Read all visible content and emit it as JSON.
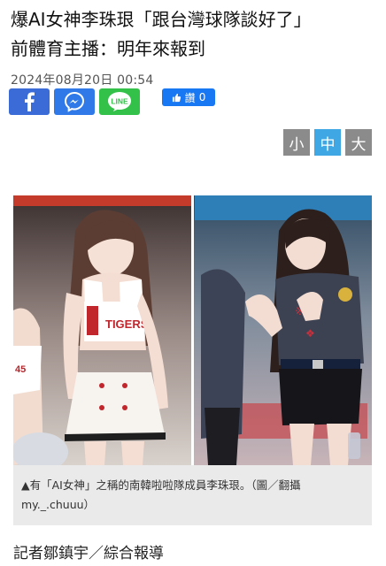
{
  "article": {
    "headline_line1": "爆AI女神李珠珢「跟台灣球隊談好了」",
    "headline_line2": "前體育主播：明年來報到",
    "date": "2024年08月20日  00:54"
  },
  "share": {
    "facebook_icon": "facebook-icon",
    "messenger_icon": "messenger-icon",
    "line_icon": "line-icon",
    "line_label": "LINE",
    "like_label": "讚",
    "like_count": "0",
    "brand_colors": {
      "facebook": "#3b6bd6",
      "messenger": "#2f7ae8",
      "line": "#33c14a",
      "like": "#1877f2"
    }
  },
  "font_size": {
    "small": "小",
    "medium": "中",
    "large": "大",
    "active": "medium",
    "active_color": "#3fa7e4",
    "inactive_color": "#8b8b8b"
  },
  "photo": {
    "jersey_left": "TIGERS",
    "jersey_left_side": "45"
  },
  "caption": {
    "text": "▲有「AI女神」之稱的南韓啦啦隊成員李珠珢。（圖／翻攝my._.chuuu）"
  },
  "byline": {
    "text": "記者鄒鎮宇／綜合報導"
  }
}
